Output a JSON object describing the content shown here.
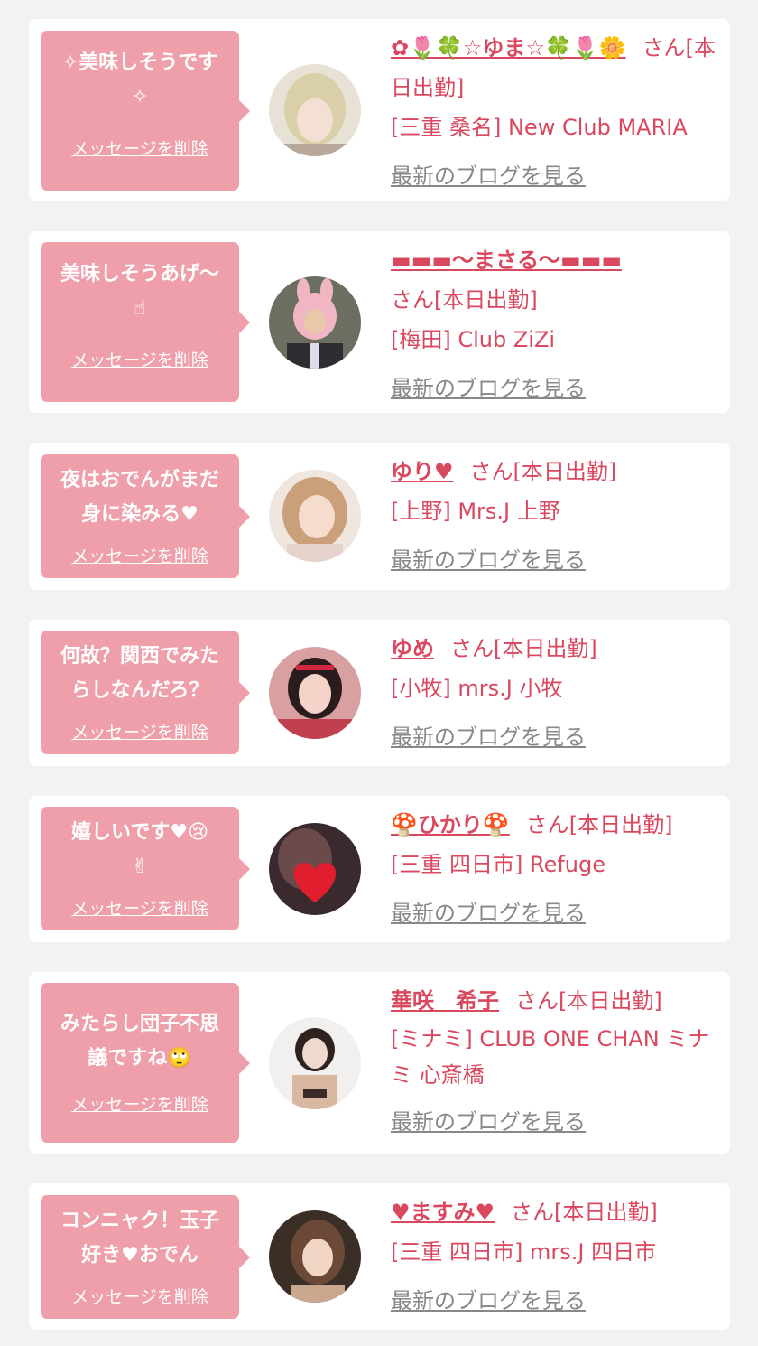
{
  "colors": {
    "accent": "#d9485e",
    "bubble": "#ee9faa",
    "link_gray": "#888888"
  },
  "cards": [
    {
      "message": "✧美味しそうです\n✧",
      "delete_label": "メッセージを削除",
      "name": "✿🌷🍀☆ゆま☆🍀🌷🌼",
      "suffix": "さん[本日出勤]",
      "shop": "[三重 桑名] New Club MARIA",
      "blog_label": "最新のブログを見る"
    },
    {
      "message": "美味しそうあげ〜\n☝",
      "delete_label": "メッセージを削除",
      "name": "▬▬▬〜まさる〜▬▬▬",
      "suffix": "さん[本日出勤]",
      "shop": "[梅田] Club ZiZi",
      "blog_label": "最新のブログを見る"
    },
    {
      "message": "夜はおでんがまだ\n身に染みる♥",
      "delete_label": "メッセージを削除",
      "name": "ゆり♥",
      "suffix": "さん[本日出勤]",
      "shop": "[上野] Mrs.J 上野",
      "blog_label": "最新のブログを見る"
    },
    {
      "message": "何故？関西でみた\nらしなんだろ？",
      "delete_label": "メッセージを削除",
      "name": "ゆめ",
      "suffix": "さん[本日出勤]",
      "shop": "[小牧] mrs.J 小牧",
      "blog_label": "最新のブログを見る"
    },
    {
      "message": "嬉しいです♥😢\n✌",
      "delete_label": "メッセージを削除",
      "name": "🍄ひかり🍄",
      "suffix": "さん[本日出勤]",
      "shop": "[三重 四日市] Refuge",
      "blog_label": "最新のブログを見る"
    },
    {
      "message": "みたらし団子不思\n議ですね🙄",
      "delete_label": "メッセージを削除",
      "name": "華咲　希子",
      "suffix": "さん[本日出勤]",
      "shop": "[ミナミ] CLUB ONE CHAN ミナミ 心斎橋",
      "blog_label": "最新のブログを見る"
    },
    {
      "message": "コンニャク！玉子\n好き♥おでん",
      "delete_label": "メッセージを削除",
      "name": "♥ますみ♥",
      "suffix": "さん[本日出勤]",
      "shop": "[三重 四日市] mrs.J 四日市",
      "blog_label": "最新のブログを見る"
    }
  ]
}
